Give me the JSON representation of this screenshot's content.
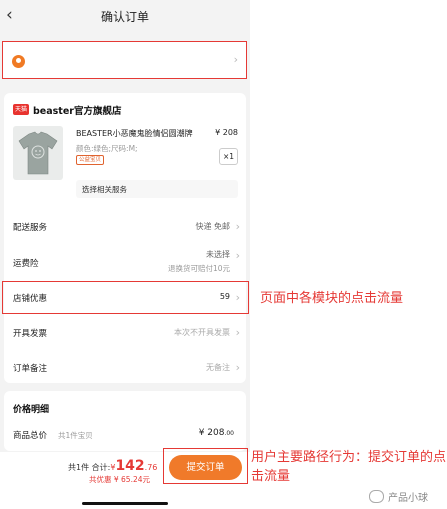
{
  "header": {
    "back_glyph": "‹",
    "title": "确认订单"
  },
  "address": {
    "pin_icon": "location-pin-icon",
    "chevron": "›"
  },
  "store": {
    "logo_text": "天猫",
    "name": "beaster官方旗舰店"
  },
  "product": {
    "name": "BEASTER小恶魔鬼脸情侣圆潮牌",
    "price": "¥ 208",
    "spec": "颜色:绿色;尺码:M;",
    "tag": "公益宝贝",
    "qty": "×1",
    "service_label": "选择相关服务"
  },
  "rows": {
    "delivery": {
      "label": "配送服务",
      "value": "快递 免邮"
    },
    "shipping_insurance": {
      "label": "运费险",
      "value": "未选择",
      "sub": "退换货可赔付10元"
    },
    "store_discount": {
      "label": "店铺优惠",
      "value": "59"
    },
    "invoice": {
      "label": "开具发票",
      "value": "本次不开具发票"
    },
    "remark": {
      "label": "订单备注",
      "value": "无备注"
    }
  },
  "price_detail": {
    "title": "价格明细",
    "label": "商品总价",
    "count": "共1件宝贝",
    "amount_main": "¥ 208",
    "amount_cents": ".00"
  },
  "footer": {
    "count": "共1件",
    "total_label": "合计:",
    "currency": "¥",
    "total_main": "142",
    "total_cents": ".76",
    "saved": "共优惠 ¥ 65.24元",
    "submit_label": "提交订单"
  },
  "annotations": {
    "store_note": "页面中各模块的点击流量",
    "submit_note": "用户主要路径行为：提交订单的点击流量"
  },
  "watermark": {
    "text": "产品小球"
  },
  "colors": {
    "accent": "#f07a2a",
    "annotation": "#e53935",
    "background": "#f3f3f3"
  }
}
